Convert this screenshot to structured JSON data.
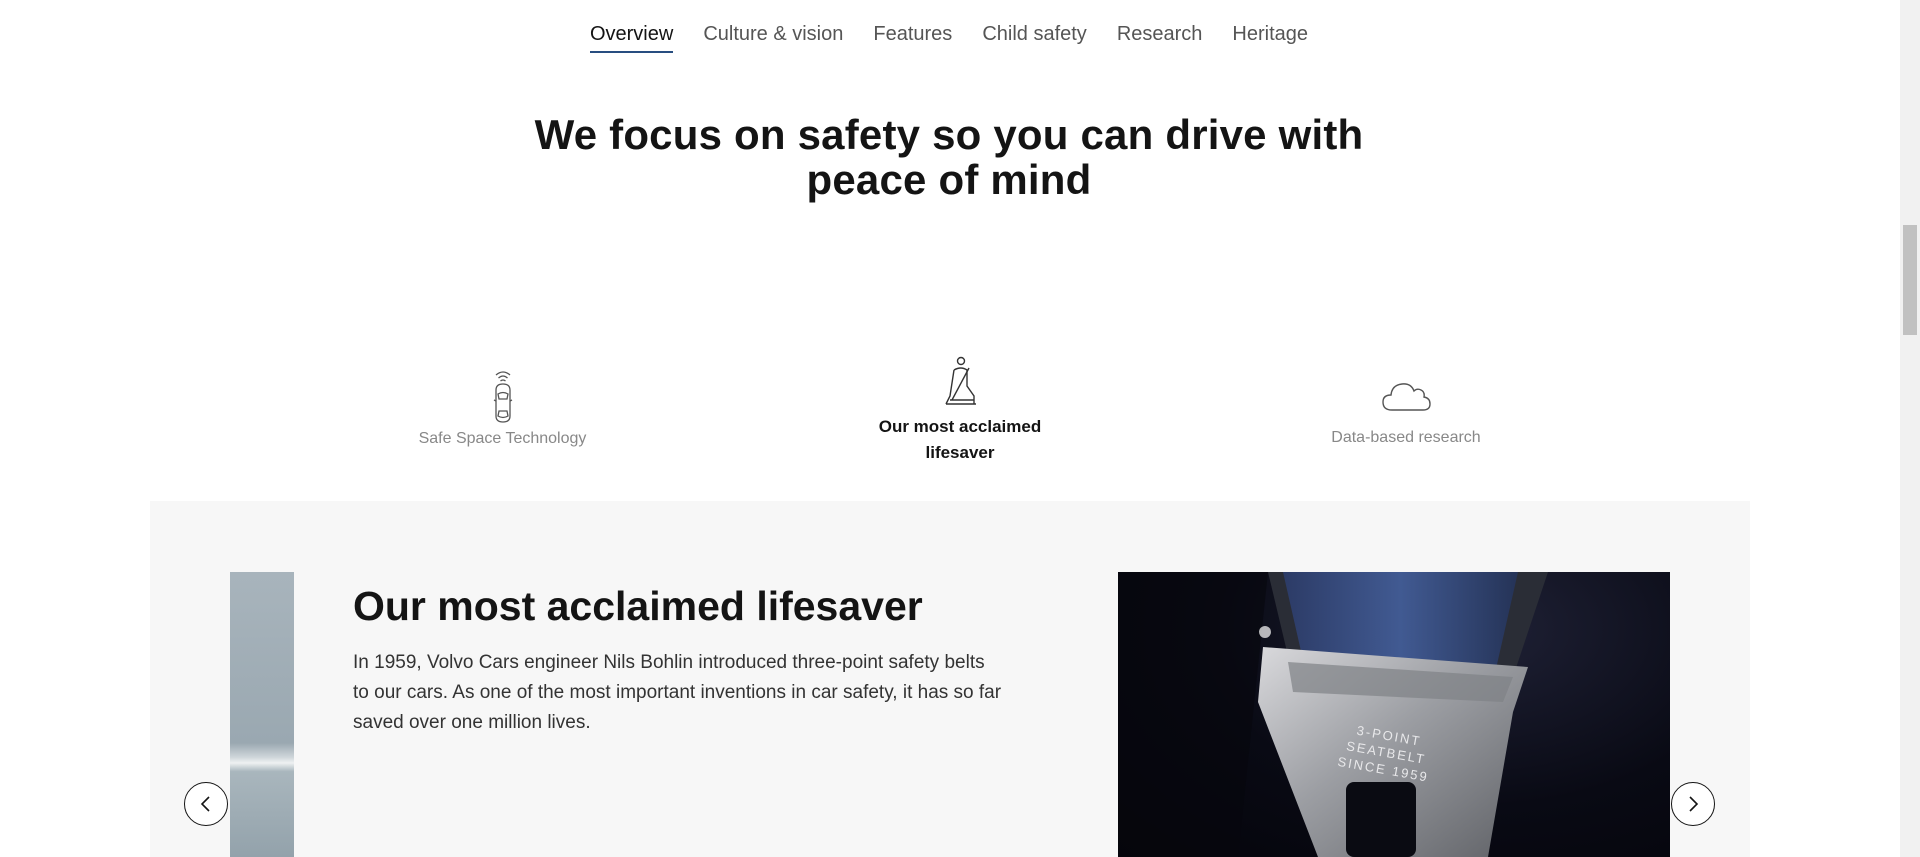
{
  "tabs": [
    {
      "label": "Overview",
      "active": true
    },
    {
      "label": "Culture & vision",
      "active": false
    },
    {
      "label": "Features",
      "active": false
    },
    {
      "label": "Child safety",
      "active": false
    },
    {
      "label": "Research",
      "active": false
    },
    {
      "label": "Heritage",
      "active": false
    }
  ],
  "hero": {
    "title": "We focus on safety so you can drive with peace of mind"
  },
  "features": [
    {
      "label": "Safe Space Technology",
      "icon": "car-sensor-icon",
      "active": false
    },
    {
      "label": "Our most acclaimed lifesaver",
      "icon": "seatbelt-person-icon",
      "active": true
    },
    {
      "label": "Data-based research",
      "icon": "cloud-icon",
      "active": false
    }
  ],
  "slide": {
    "title": "Our most acclaimed lifesaver",
    "text": "In 1959, Volvo Cars engineer Nils Bohlin introduced three-point safety belts to our cars. As one of the most important inventions in car safety, it has so far saved over one million lives.",
    "image_engraving": [
      "3-POINT",
      "SEATBELT",
      "SINCE 1959"
    ]
  },
  "colors": {
    "accent": "#284e80",
    "text": "#141414",
    "muted": "#888888",
    "panel": "#f7f7f7"
  }
}
